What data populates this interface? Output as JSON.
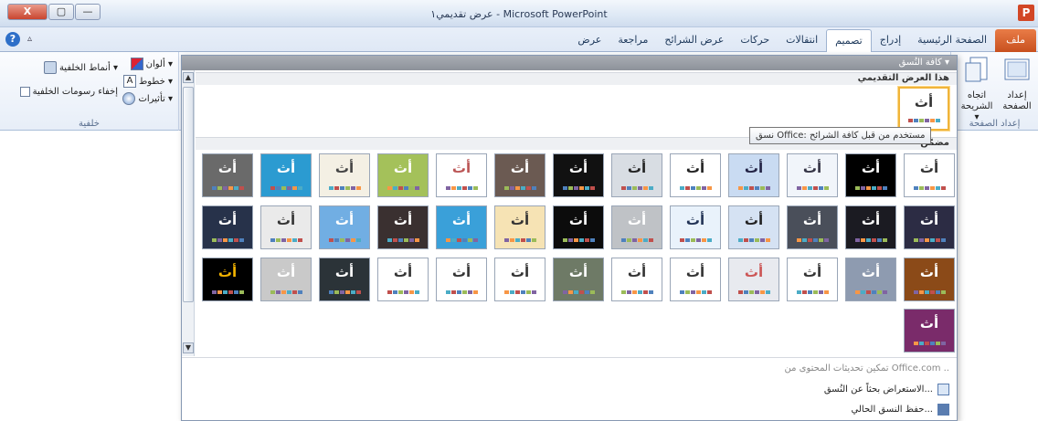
{
  "window": {
    "title": "عرض تقديمي١ - Microsoft PowerPoint",
    "app_icon": "P",
    "controls": [
      "X",
      "▢",
      "—"
    ]
  },
  "ribbon_tabs": [
    {
      "label": "ملف",
      "type": "file"
    },
    {
      "label": "الصفحة الرئيسية"
    },
    {
      "label": "إدراج"
    },
    {
      "label": "تصميم",
      "active": true
    },
    {
      "label": "انتقالات"
    },
    {
      "label": "حركات"
    },
    {
      "label": "عرض الشرائح"
    },
    {
      "label": "مراجعة"
    },
    {
      "label": "عرض"
    }
  ],
  "help": {
    "help_glyph": "?",
    "caret_glyph": "▵"
  },
  "page_setup": {
    "setup_label": "إعداد الصفحة",
    "orientation_label": "اتجاه الشريحة ▾",
    "group_label": "إعداد الصفحة"
  },
  "background": {
    "styles_label": "أنماط الخلفية ▾",
    "hide_graphics_label": "إخفاء رسومات الخلفية",
    "group_label": "خلفية"
  },
  "variants": {
    "colors_label": "ألوان ▾",
    "fonts_label": "خطوط ▾",
    "effects_label": "تأثيرات ▾"
  },
  "gallery": {
    "header": "كافة النُسق ▾",
    "section_current": "هذا العرض التقديمي",
    "section_builtin": "مضمّن",
    "glyph": "أث",
    "tooltip": "نسق Office: مستخدم من قبل كافة الشرائح",
    "footer": {
      "update_text": "تمكين تحديثات المحتوى من Office.com ..",
      "browse_text": "الاستعراض بحثاً عن النُسق...",
      "save_text": "حفظ النسق الحالي..."
    }
  },
  "colors": {
    "accent_file": "#d24726",
    "selected_border": "#f0b43a"
  }
}
